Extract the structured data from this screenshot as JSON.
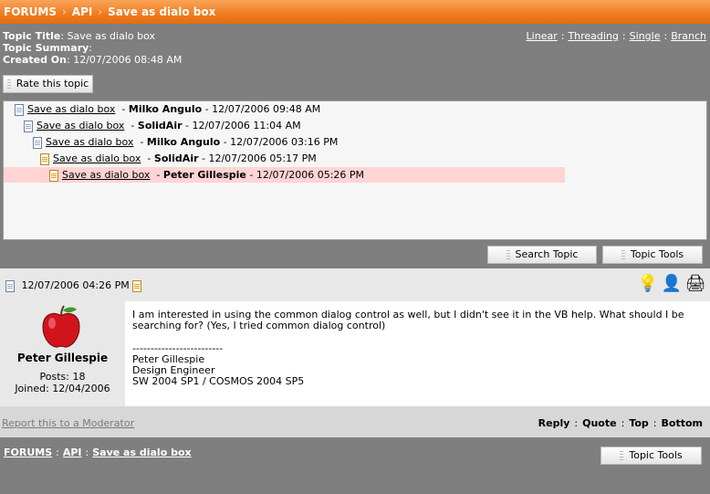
{
  "breadcrumb": {
    "forums": "FORUMS",
    "api": "API",
    "current": "Save as dialo box",
    "separator": "›",
    "sep_colon": ":"
  },
  "topic": {
    "title_label": "Topic Title",
    "title_value": "Save as dialo box",
    "summary_label": "Topic Summary",
    "summary_value": "",
    "created_label": "Created On",
    "created_value": "12/07/2006 08:48 AM",
    "colon": ":"
  },
  "views": {
    "linear": "Linear",
    "threading": "Threading",
    "single": "Single",
    "branch": "Branch",
    "sep": ":"
  },
  "buttons": {
    "rate": "Rate this topic",
    "search": "Search Topic",
    "tools": "Topic Tools"
  },
  "thread": [
    {
      "title": "Save as dialo box",
      "dash": "-",
      "author": "Milko Angulo",
      "date": "- 12/07/2006 09:48 AM",
      "icon": "post-doc-icon",
      "selected": false
    },
    {
      "title": "Save as dialo box",
      "dash": "-",
      "author": "SolidAir",
      "date": "- 12/07/2006 11:04 AM",
      "icon": "post-doc-icon",
      "selected": false
    },
    {
      "title": "Save as dialo box",
      "dash": "-",
      "author": "Milko Angulo",
      "date": "- 12/07/2006 03:16 PM",
      "icon": "post-doc-icon",
      "selected": false
    },
    {
      "title": "Save as dialo box",
      "dash": "-",
      "author": "SolidAir",
      "date": "- 12/07/2006 05:17 PM",
      "icon": "new-post-doc-icon",
      "selected": false
    },
    {
      "title": "Save as dialo box",
      "dash": "-",
      "author": "Peter Gillespie",
      "date": "- 12/07/2006 05:26 PM",
      "icon": "new-post-doc-icon",
      "selected": true
    }
  ],
  "post": {
    "date": "12/07/2006 04:26 PM",
    "author": "Peter Gillespie",
    "posts": "Posts: 18",
    "joined": "Joined: 12/04/2006",
    "body_line1": "I am interested in using the common dialog control as well, but I didn't see it in the VB help. What should I be searching for? (Yes, I tried common dialog control)",
    "sig_rule": "-------------------------",
    "sig_name": "Peter Gillespie",
    "sig_title": "Design Engineer",
    "sig_versions": "SW 2004 SP1 / COSMOS 2004 SP5"
  },
  "footer": {
    "report": "Report this to a Moderator",
    "reply": "Reply",
    "quote": "Quote",
    "top": "Top",
    "bottom": "Bottom",
    "sep": ":"
  },
  "colors": {
    "header_orange": "#f07b1e",
    "selected_row": "#ffd4d4",
    "page_gray": "#7f7f7f"
  }
}
